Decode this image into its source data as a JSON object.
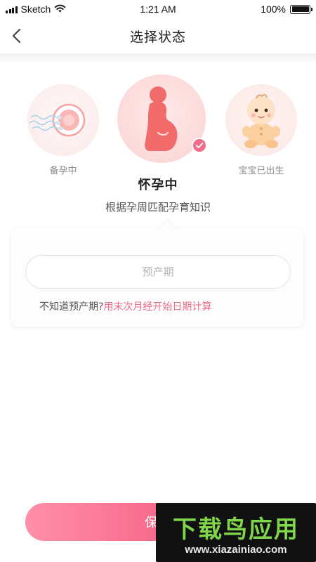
{
  "status_bar": {
    "carrier": "Sketch",
    "time": "1:21 AM",
    "battery_text": "100%",
    "battery_level": 1.0
  },
  "nav": {
    "title": "选择状态",
    "back_icon": "chevron-left-icon"
  },
  "options": [
    {
      "label": "备孕中",
      "icon": "egg-sperm-icon",
      "selected": false
    },
    {
      "label": "怀孕中",
      "icon": "pregnant-belly-icon",
      "selected": true
    },
    {
      "label": "宝宝已出生",
      "icon": "baby-icon",
      "selected": false
    }
  ],
  "selected": {
    "title": "怀孕中",
    "description": "根据孕周匹配孕育知识"
  },
  "due_date": {
    "value": "",
    "placeholder": "预产期"
  },
  "hint": {
    "question": "不知道预产期?",
    "link": "用末次月经开始日期计算"
  },
  "save_button": {
    "label": "保存"
  },
  "watermark": {
    "title": "下载鸟应用",
    "url": "www.xiazainiao.com"
  },
  "colors": {
    "accent": "#f06a8a",
    "link": "#ec6c87",
    "watermark_green": "#7fd64a"
  }
}
